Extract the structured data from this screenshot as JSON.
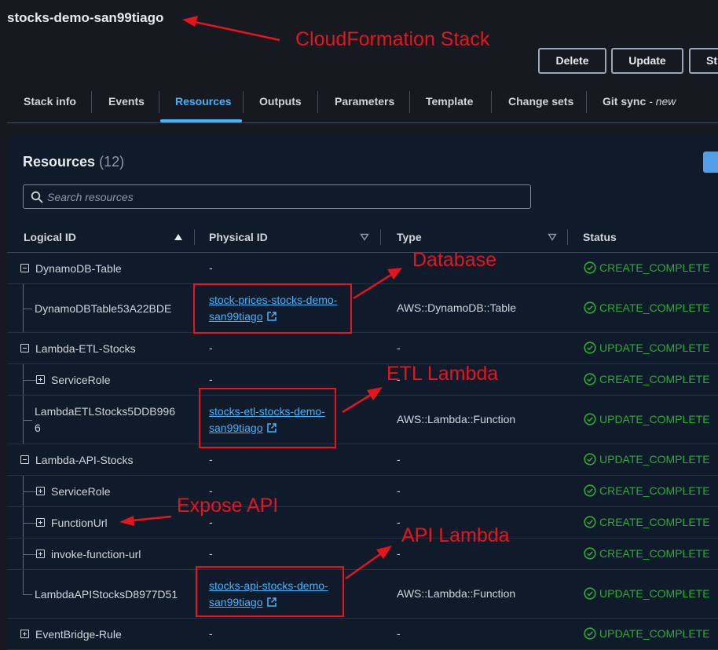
{
  "header": {
    "title": "stocks-demo-san99tiago",
    "buttons": {
      "delete": "Delete",
      "update": "Update",
      "more": "St"
    }
  },
  "tabs": [
    {
      "label": "Stack info"
    },
    {
      "label": "Events"
    },
    {
      "label": "Resources",
      "active": true
    },
    {
      "label": "Outputs"
    },
    {
      "label": "Parameters"
    },
    {
      "label": "Template"
    },
    {
      "label": "Change sets"
    },
    {
      "label": "Git sync",
      "suffix": "- new"
    }
  ],
  "resources": {
    "title": "Resources",
    "count": "(12)",
    "search_placeholder": "Search resources",
    "columns": {
      "logical_id": "Logical ID",
      "physical_id": "Physical ID",
      "type": "Type",
      "status": "Status"
    },
    "rows": [
      {
        "logical_line1": "DynamoDB-Table",
        "toggle": "minus",
        "physical": "-",
        "type": "-",
        "status": "CREATE_COMPLETE"
      },
      {
        "logical_line1": "DynamoDBTable53A22BDE",
        "toggle": "none",
        "physical_line1": "stock-prices-stocks-demo-",
        "physical_line2": "san99tiago",
        "type": "AWS::DynamoDB::Table",
        "status": "CREATE_COMPLETE"
      },
      {
        "logical_line1": "Lambda-ETL-Stocks",
        "toggle": "minus",
        "physical": "-",
        "type": "-",
        "status": "UPDATE_COMPLETE"
      },
      {
        "logical_line1": "ServiceRole",
        "toggle": "plus",
        "physical": "-",
        "type": "-",
        "status": "CREATE_COMPLETE"
      },
      {
        "logical_line1": "LambdaETLStocks5DDB996",
        "logical_line2": "6",
        "toggle": "none",
        "physical_line1": "stocks-etl-stocks-demo-",
        "physical_line2": "san99tiago",
        "type": "AWS::Lambda::Function",
        "status": "UPDATE_COMPLETE"
      },
      {
        "logical_line1": "Lambda-API-Stocks",
        "toggle": "minus",
        "physical": "-",
        "type": "-",
        "status": "UPDATE_COMPLETE"
      },
      {
        "logical_line1": "ServiceRole",
        "toggle": "plus",
        "physical": "-",
        "type": "-",
        "status": "CREATE_COMPLETE"
      },
      {
        "logical_line1": "FunctionUrl",
        "toggle": "plus",
        "physical": "-",
        "type": "-",
        "status": "CREATE_COMPLETE"
      },
      {
        "logical_line1": "invoke-function-url",
        "toggle": "plus",
        "physical": "-",
        "type": "-",
        "status": "CREATE_COMPLETE"
      },
      {
        "logical_line1": "LambdaAPIStocksD8977D51",
        "toggle": "none",
        "physical_line1": "stocks-api-stocks-demo-",
        "physical_line2": "san99tiago",
        "type": "AWS::Lambda::Function",
        "status": "UPDATE_COMPLETE"
      },
      {
        "logical_line1": "EventBridge-Rule",
        "toggle": "plus",
        "physical": "-",
        "type": "-",
        "status": "UPDATE_COMPLETE"
      }
    ]
  },
  "annotations": {
    "cloudformation": "CloudFormation Stack",
    "database": "Database",
    "etl_lambda": "ETL Lambda",
    "expose_api": "Expose API",
    "api_lambda": "API Lambda",
    "color": "#e8141d"
  },
  "colors": {
    "background": "#16191f",
    "panel": "#0f1b2a",
    "accent": "#42b4ff",
    "success": "#29ad32"
  }
}
